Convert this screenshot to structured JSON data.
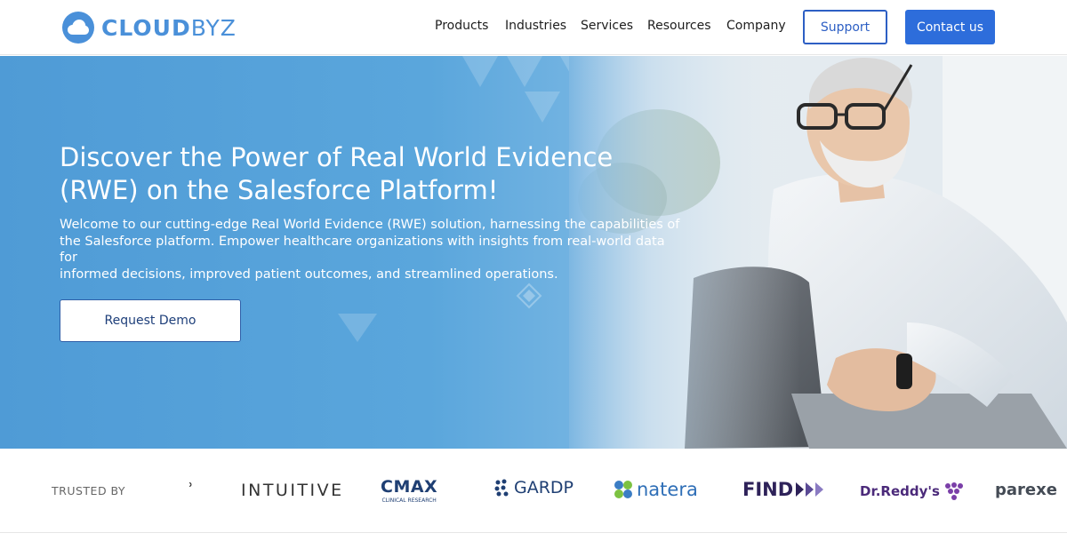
{
  "header": {
    "logo": {
      "primary": "CLOUD",
      "secondary": "BYZ"
    },
    "nav": [
      "Products",
      "Industries",
      "Services",
      "Resources",
      "Company"
    ],
    "support_label": "Support",
    "contact_label": "Contact us"
  },
  "hero": {
    "title_line1": "Discover the Power of Real World Evidence",
    "title_line2": "(RWE) on the Salesforce Platform!",
    "desc_line1": "Welcome to our cutting-edge Real World Evidence (RWE) solution, harnessing the capabilities of",
    "desc_line2": "the Salesforce platform. Empower healthcare organizations with insights from real-world data for",
    "desc_line3": "informed decisions, improved patient outcomes, and streamlined operations.",
    "cta_label": "Request Demo"
  },
  "trusted": {
    "label": "TRUSTED BY",
    "brands": {
      "intuitive": "INTUITIVE",
      "cmax": "CMAX",
      "cmax_sub": "CLINICAL RESEARCH",
      "gardp": "GARDP",
      "natera": "natera",
      "find": "FIND",
      "drreddys": "Dr.Reddy's",
      "parexel": "parexe"
    }
  },
  "colors": {
    "brand_blue": "#4a90d9",
    "nav_text": "#1d1d1d",
    "support_border": "#2d5fc4",
    "contact_bg": "#2d6ddb",
    "hero_blue": "#5aa6dc"
  }
}
